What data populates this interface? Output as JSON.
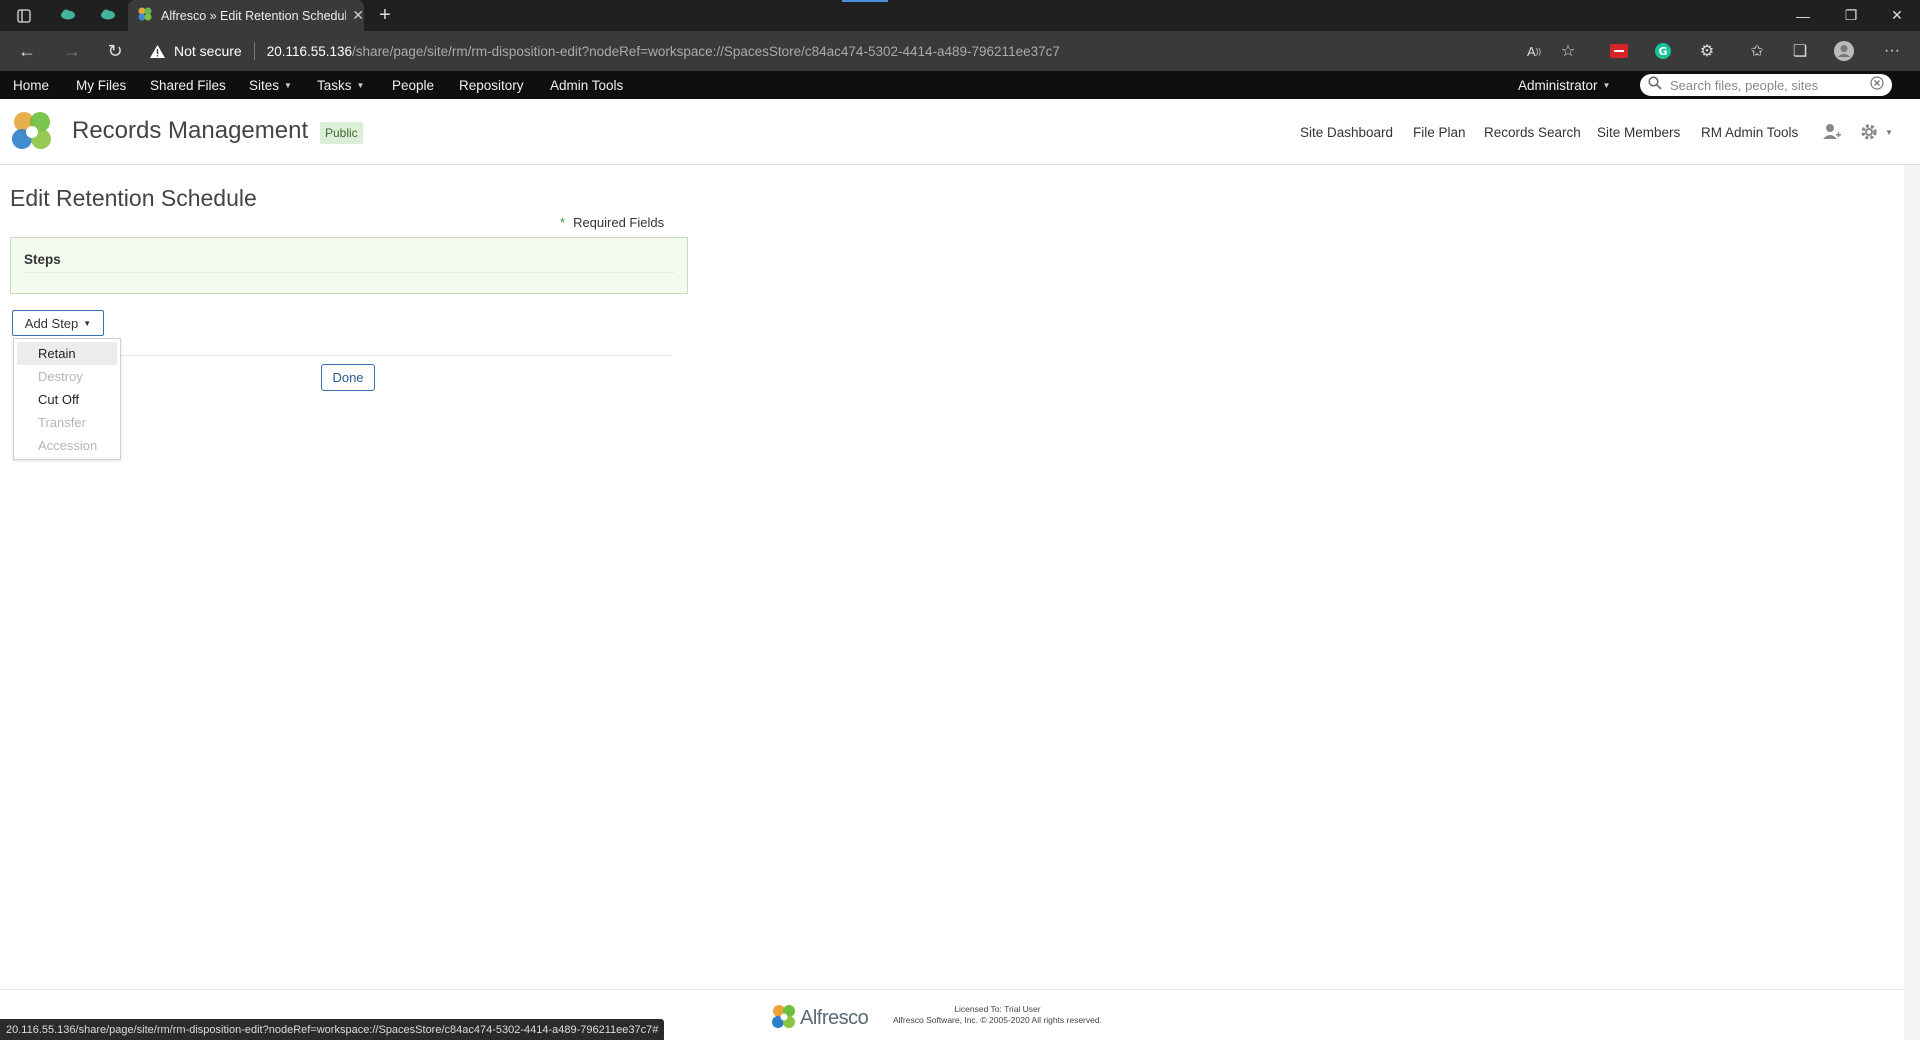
{
  "browser": {
    "tab_title": "Alfresco » Edit Retention Schedule",
    "not_secure_label": "Not secure",
    "url_host": "20.116.55.136",
    "url_path": "/share/page/site/rm/rm-disposition-edit?nodeRef=workspace://SpacesStore/c84ac474-5302-4414-a489-796211ee37c7",
    "status_url": "20.116.55.136/share/page/site/rm/rm-disposition-edit?nodeRef=workspace://SpacesStore/c84ac474-5302-4414-a489-796211ee37c7#"
  },
  "header": {
    "menu": [
      "Home",
      "My Files",
      "Shared Files",
      "Sites",
      "Tasks",
      "People",
      "Repository",
      "Admin Tools"
    ],
    "user": "Administrator",
    "search_placeholder": "Search files, people, sites"
  },
  "site": {
    "title": "Records Management",
    "visibility": "Public",
    "nav": [
      "Site Dashboard",
      "File Plan",
      "Records Search",
      "Site Members",
      "RM Admin Tools"
    ]
  },
  "main": {
    "page_title": "Edit Retention Schedule",
    "required_label": "Required Fields",
    "required_star": "*",
    "steps_label": "Steps",
    "add_step_label": "Add Step",
    "done_label": "Done",
    "dropdown": [
      {
        "label": "Retain",
        "state": "hover"
      },
      {
        "label": "Destroy",
        "state": "disabled"
      },
      {
        "label": "Cut Off",
        "state": "enabled"
      },
      {
        "label": "Transfer",
        "state": "disabled"
      },
      {
        "label": "Accession",
        "state": "disabled"
      }
    ]
  },
  "footer": {
    "brand": "Alfresco",
    "license_line1": "Licensed To: Trial User",
    "license_line2": "Alfresco Software, Inc. © 2005-2020 All rights reserved."
  },
  "colors": {
    "accent": "#3a6fb0",
    "header_bg": "#0f0f0f",
    "steps_bg": "#f3faee",
    "chrome_bg": "#202020"
  }
}
